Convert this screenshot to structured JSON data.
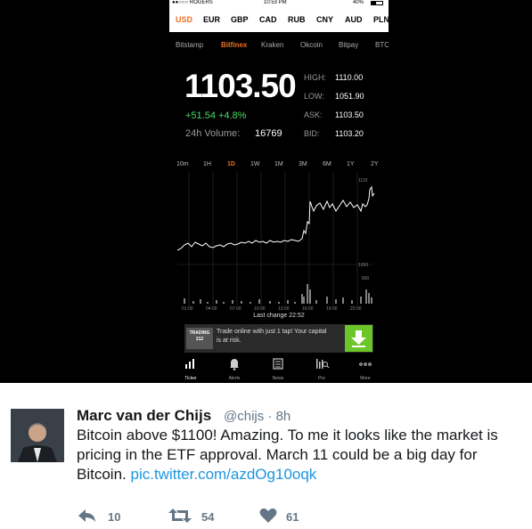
{
  "screenshot": {
    "status_bar": {
      "carrier": "●●○○○ ROGERS",
      "time": "10:53 PM",
      "battery": "40%"
    },
    "currencies": [
      "USD",
      "EUR",
      "GBP",
      "CAD",
      "RUB",
      "CNY",
      "AUD",
      "PLN"
    ],
    "active_currency": "USD",
    "exchanges": [
      "Bitstamp",
      "Bitfinex",
      "Kraken",
      "Okcoin",
      "Bitpay",
      "BTC"
    ],
    "active_exchange": "Bitfinex",
    "price": "1103.50",
    "change": "+51.54 +4.8%",
    "volume_label": "24h Volume:",
    "volume_value": "16769",
    "stats": [
      {
        "label": "HIGH:",
        "value": "1110.00"
      },
      {
        "label": "LOW:",
        "value": "1051.90"
      },
      {
        "label": "ASK:",
        "value": "1103.50"
      },
      {
        "label": "BID:",
        "value": "1103.20"
      }
    ],
    "ranges": [
      "10m",
      "1H",
      "1D",
      "1W",
      "1M",
      "3M",
      "6M",
      "1Y",
      "2Y"
    ],
    "active_range": "1D",
    "y_ticks": [
      "1110",
      "1050",
      "800"
    ],
    "x_ticks": [
      "01:00",
      "04:00",
      "07:00",
      "10:00",
      "13:00",
      "16:00",
      "19:00",
      "22:00"
    ],
    "last_change": "Last change 22:52",
    "ad": {
      "logo": "TRADING 212",
      "text": "Trade online with just 1 tap! Your capital is at risk."
    },
    "tabs": [
      "Ticker",
      "Alerts",
      "News",
      "Pro",
      "More"
    ],
    "active_tab": "Ticker",
    "colors": {
      "accent": "#f0701e",
      "positive": "#4cd964",
      "ad_button": "#6cc62a"
    }
  },
  "tweet": {
    "name": "Marc van der Chijs",
    "handle": "@chijs · 8h",
    "text": "Bitcoin above $1100! Amazing. To me it looks like the market is pricing in the ETF approval. March 11 could be a big day for Bitcoin. ",
    "link": "pic.twitter.com/azdOg10oqk",
    "reply_count": "10",
    "retweet_count": "54",
    "like_count": "61",
    "colors": {
      "link": "#1b95e0",
      "muted": "#657786"
    }
  }
}
